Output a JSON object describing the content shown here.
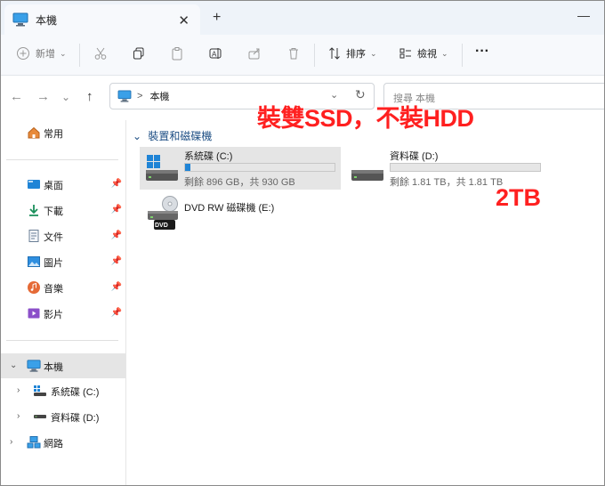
{
  "window": {
    "tab_title": "本機",
    "add_tab": "+",
    "close_tab": "✕",
    "minimize": "—"
  },
  "toolbar": {
    "new_label": "新增",
    "sort_label": "排序",
    "view_label": "檢視",
    "more_label": "···"
  },
  "address": {
    "separator": ">",
    "location": "本機",
    "search_placeholder": "搜尋 本機"
  },
  "sidebar": {
    "home": "常用",
    "pinned": [
      {
        "label": "桌面"
      },
      {
        "label": "下載"
      },
      {
        "label": "文件"
      },
      {
        "label": "圖片"
      },
      {
        "label": "音樂"
      },
      {
        "label": "影片"
      }
    ],
    "this_pc": "本機",
    "drives": [
      {
        "label": "系統碟 (C:)"
      },
      {
        "label": "資料碟 (D:)"
      }
    ],
    "network": "網路"
  },
  "main": {
    "group_header": "裝置和磁碟機",
    "drives": [
      {
        "name": "系統碟 (C:)",
        "free_text": "剩餘 896 GB，共 930 GB",
        "used_fraction": 0.037
      },
      {
        "name": "資料碟 (D:)",
        "free_text": "剩餘 1.81 TB，共 1.81 TB",
        "used_fraction": 0.0
      },
      {
        "name": "DVD RW 磁碟機 (E:)",
        "badge": "DVD"
      }
    ]
  },
  "annotations": {
    "main": "裝雙SSD，不裝HDD",
    "capacity": "2TB"
  },
  "colors": {
    "accent": "#1f84d6",
    "annotation": "#ff2020",
    "group_header": "#1d4e84",
    "selection": "#e5e5e5"
  }
}
